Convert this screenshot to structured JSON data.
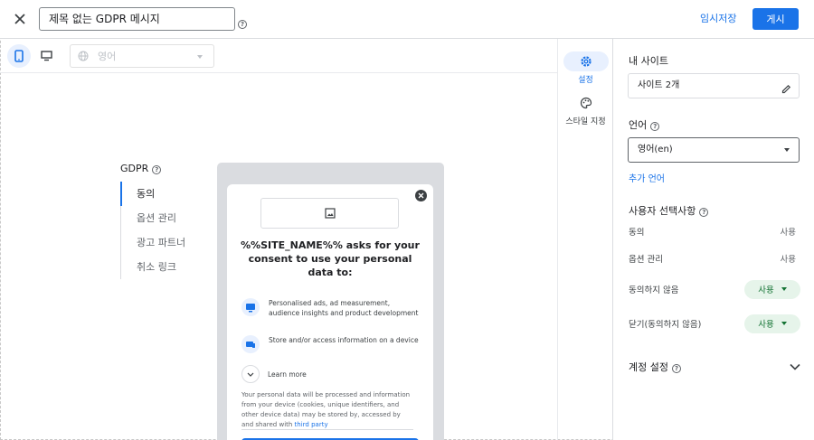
{
  "header": {
    "title_value": "제목 없는 GDPR 메시지",
    "draft_label": "임시저장",
    "publish_label": "게시"
  },
  "toolbar": {
    "language_value": "영어"
  },
  "message_nav": {
    "heading": "GDPR",
    "items": [
      "동의",
      "옵션 관리",
      "광고 파트너",
      "취소 링크"
    ]
  },
  "preview": {
    "title": "%%SITE_NAME%% asks for your consent to use your personal data to:",
    "purposes": [
      "Personalised ads, ad measurement, audience insights and product development",
      "Store and/or access information on a device"
    ],
    "learn_more": "Learn more",
    "fine_print": "Your personal data will be processed and information from your device (cookies, unique identifiers, and other device data) may be stored by, accessed by and shared with ",
    "fine_print_link": "third party"
  },
  "side_tabs": {
    "settings": "설정",
    "styling": "스타일 지정"
  },
  "panel": {
    "my_site_heading": "내 사이트",
    "my_site_value": "사이트 2개",
    "language_heading": "언어",
    "language_value": "영어(en)",
    "add_language": "추가 언어",
    "user_choices_heading": "사용자 선택사항",
    "choices": [
      {
        "label": "동의",
        "value": "사용"
      },
      {
        "label": "옵션 관리",
        "value": "사용"
      },
      {
        "label": "동의하지 않음",
        "value": "사용"
      },
      {
        "label": "닫기(동의하지 않음)",
        "value": "사용"
      }
    ],
    "account_settings": "계정 설정"
  },
  "colors": {
    "accent": "#1a73e8",
    "chip_bg": "#e6f4ea",
    "chip_text": "#137333"
  },
  "icons": [
    "close-icon",
    "help-icon",
    "phone-icon",
    "desktop-icon",
    "globe-icon",
    "gear-icon",
    "palette-icon",
    "edit-icon",
    "image-icon",
    "chevron-down-icon"
  ]
}
